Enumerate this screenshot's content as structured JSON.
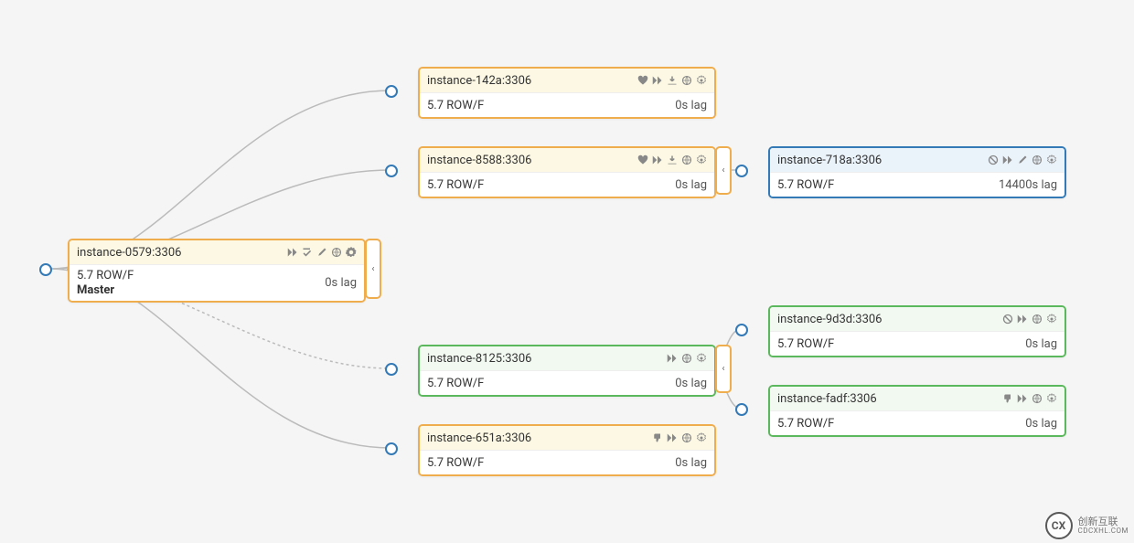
{
  "nodes": {
    "master": {
      "name": "instance-0579:3306",
      "version": "5.7 ROW/F",
      "role": "Master",
      "lag": "0s lag"
    },
    "n142a": {
      "name": "instance-142a:3306",
      "version": "5.7 ROW/F",
      "lag": "0s lag"
    },
    "n8588": {
      "name": "instance-8588:3306",
      "version": "5.7 ROW/F",
      "lag": "0s lag"
    },
    "n718a": {
      "name": "instance-718a:3306",
      "version": "5.7 ROW/F",
      "lag": "14400s lag"
    },
    "n8125": {
      "name": "instance-8125:3306",
      "version": "5.7 ROW/F",
      "lag": "0s lag"
    },
    "n651a": {
      "name": "instance-651a:3306",
      "version": "5.7 ROW/F",
      "lag": "0s lag"
    },
    "n9d3d": {
      "name": "instance-9d3d:3306",
      "version": "5.7 ROW/F",
      "lag": "0s lag"
    },
    "nfadf": {
      "name": "instance-fadf:3306",
      "version": "5.7 ROW/F",
      "lag": "0s lag"
    }
  },
  "icons": {
    "heart": "heart-icon",
    "fastforward": "fast-forward-icon",
    "check": "check-icon",
    "download": "download-icon",
    "globe": "globe-icon",
    "gear": "gear-icon",
    "ban": "ban-icon",
    "pencil": "pencil-icon",
    "thumbsdown": "thumbs-down-icon",
    "chevronLeft": "‹"
  },
  "watermark": {
    "line1": "创新互联",
    "line2": "CDCXHL.COM"
  }
}
